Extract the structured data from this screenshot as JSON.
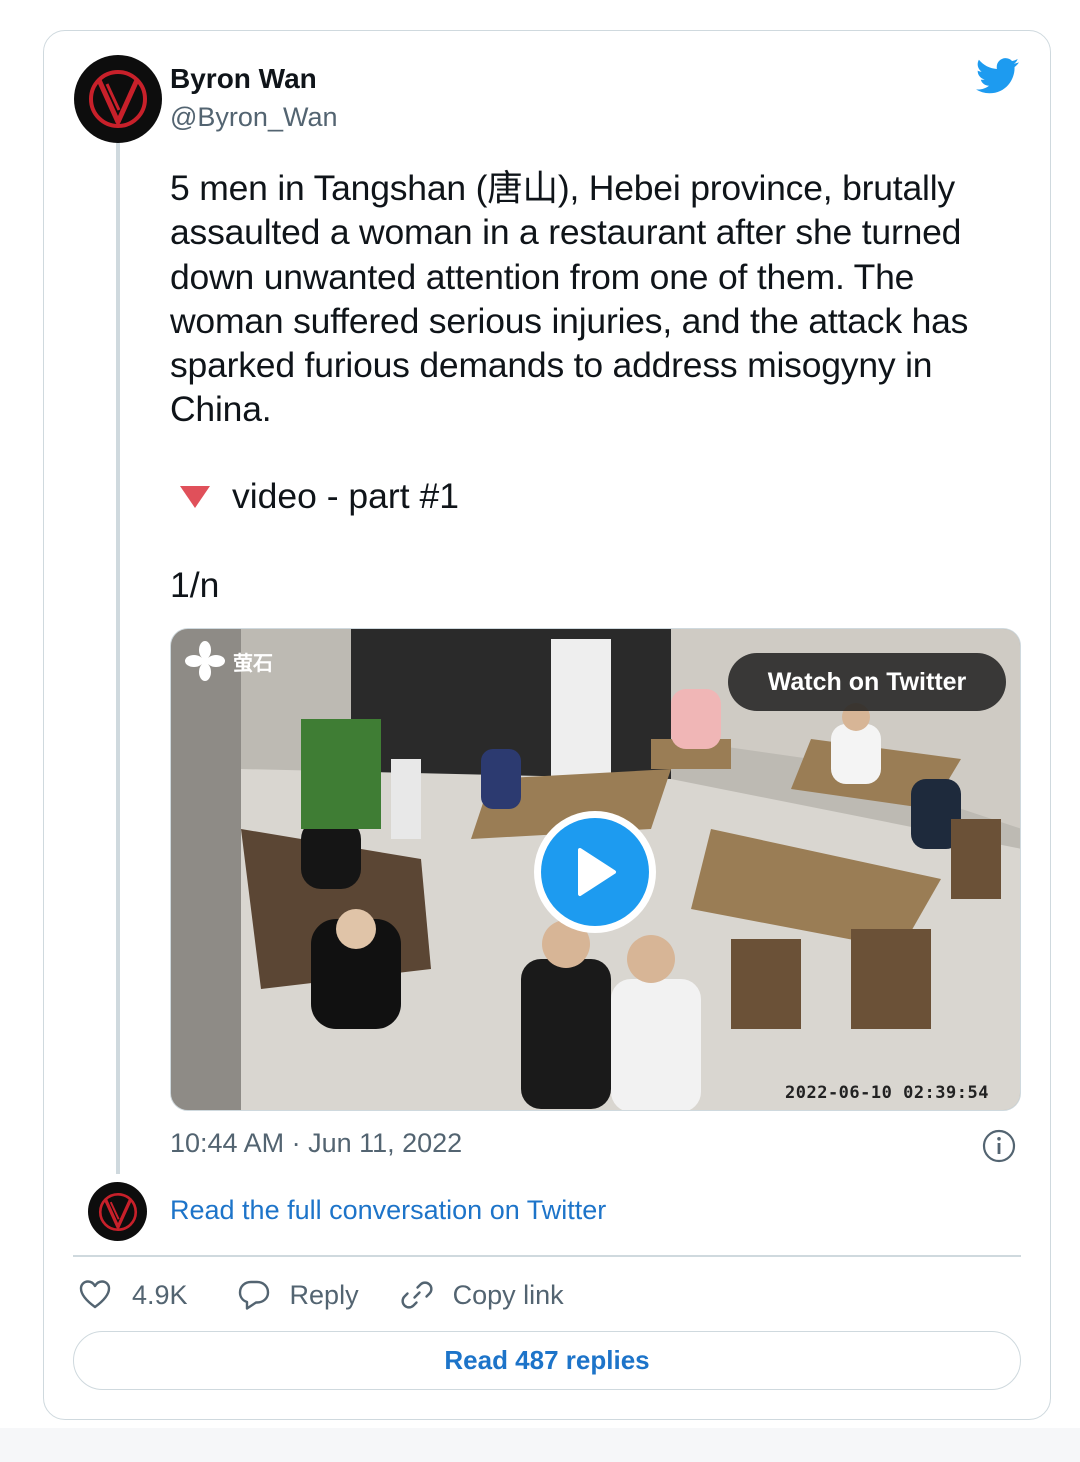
{
  "author": {
    "name": "Byron Wan",
    "handle": "@Byron_Wan",
    "avatar_icon": "v-logo-avatar-icon"
  },
  "tweet": {
    "text": "5 men in Tangshan (唐山), Hebei province, brutally assaulted a woman in a restaurant after she turned down unwanted attention from one of them. The woman suffered serious injuries, and the attack has sparked furious demands to address misogyny in China.",
    "video_label": "video - part #1",
    "thread_count": "1/n",
    "timestamp": "10:44 AM · Jun 11, 2022"
  },
  "media": {
    "watch_label": "Watch on Twitter",
    "overlay_timestamp": "2022-06-10 02:39:54",
    "brand_mark": "萤石",
    "play_icon": "play-icon"
  },
  "conversation": {
    "read_full_label": "Read the full conversation on Twitter"
  },
  "actions": {
    "like_count": "4.9K",
    "reply_label": "Reply",
    "copy_link_label": "Copy link"
  },
  "read_replies_label": "Read 487 replies",
  "colors": {
    "link_blue": "#1d74c9",
    "twitter_blue": "#1d9bf0",
    "secondary_text": "#536471",
    "border": "#cfd9de",
    "triangle_red": "#e0505a"
  }
}
